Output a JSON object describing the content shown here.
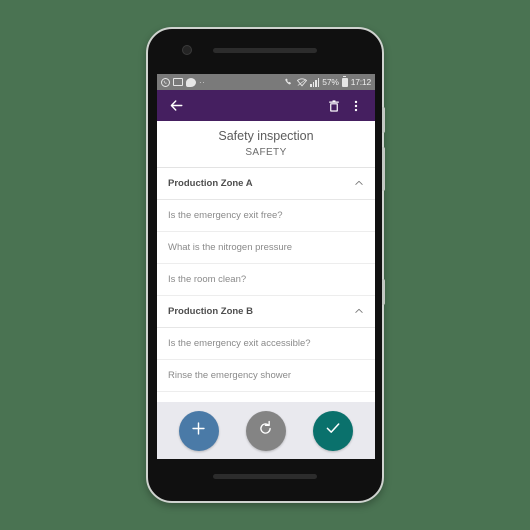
{
  "theme": {
    "page_background": "#4a7352",
    "app_bar_color": "#451f60",
    "status_bar_color": "#7a7a7a",
    "action_bar_color": "#e9e9ee",
    "fab_add_color": "#4a7aa7",
    "fab_refresh_color": "#848484",
    "fab_confirm_color": "#0a716c"
  },
  "status_bar": {
    "icons_left": [
      "whatsapp-icon",
      "photo-icon",
      "message-icon",
      "more-dots-icon"
    ],
    "icons_right": [
      "phone-call-icon",
      "wifi-icon",
      "signal-icon",
      "battery-icon"
    ],
    "battery": "57%",
    "time": "17:12"
  },
  "app_bar": {
    "back_icon": "back-arrow-icon",
    "delete_icon": "trash-icon",
    "overflow_icon": "overflow-menu-icon"
  },
  "header": {
    "title": "Safety inspection",
    "subtitle": "SAFETY"
  },
  "groups": [
    {
      "label": "Production Zone A",
      "expanded": true,
      "chevron": "chevron-up-icon",
      "items": [
        {
          "label": "Is the emergency exit free?"
        },
        {
          "label": "What is the nitrogen pressure"
        },
        {
          "label": "Is the room clean?"
        }
      ]
    },
    {
      "label": "Production Zone B",
      "expanded": true,
      "chevron": "chevron-up-icon",
      "items": [
        {
          "label": "Is the emergency exit accessible?"
        },
        {
          "label": "Rinse the emergency shower"
        }
      ]
    }
  ],
  "action_bar": {
    "buttons": [
      {
        "name": "add-button",
        "icon": "plus-icon"
      },
      {
        "name": "refresh-button",
        "icon": "refresh-icon"
      },
      {
        "name": "confirm-button",
        "icon": "check-icon"
      }
    ]
  }
}
